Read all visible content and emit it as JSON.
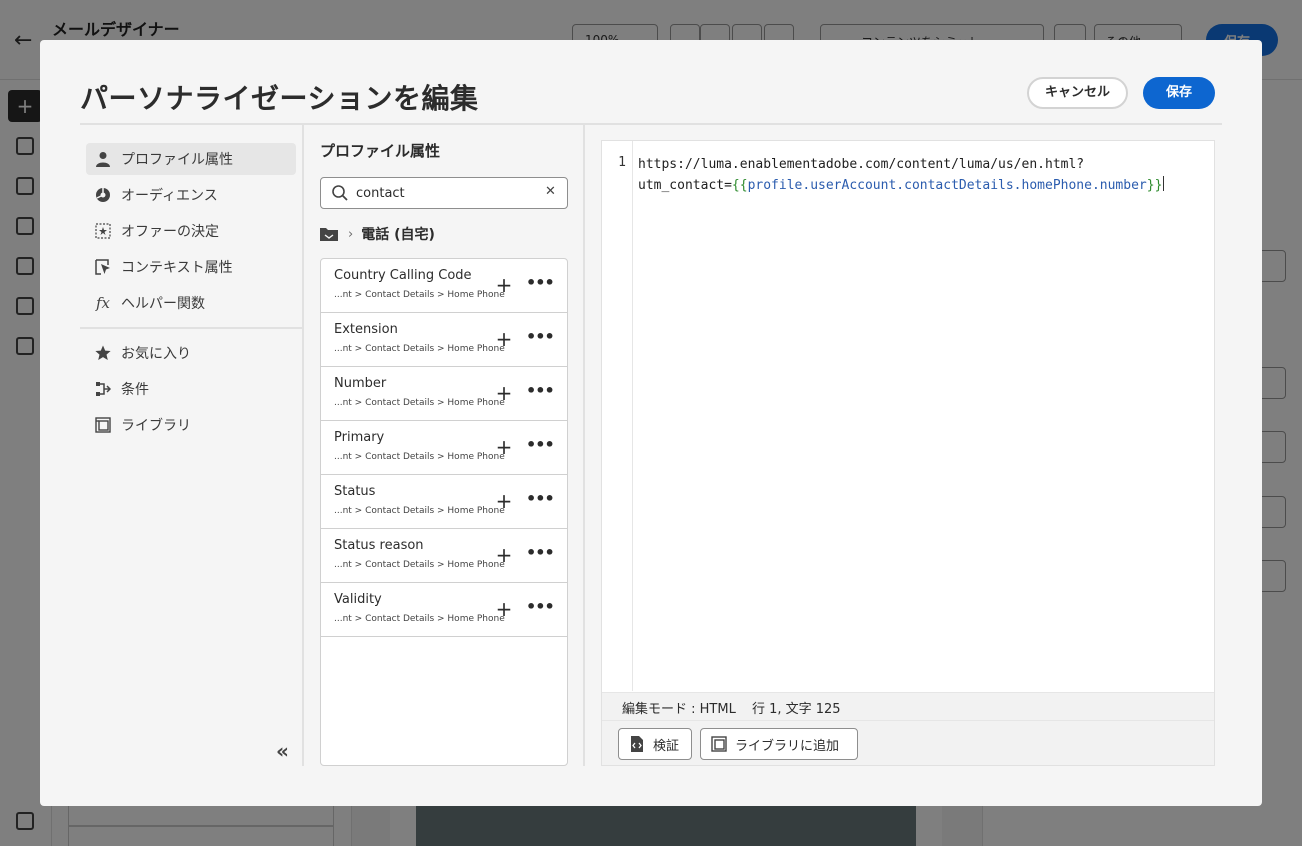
{
  "background": {
    "app_title": "メールデザイナー",
    "zoom": "100%",
    "simulate_label": "コンテンツをシミュレート",
    "more_label": "その他",
    "save_label": "保存"
  },
  "dialog": {
    "title": "パーソナライゼーションを編集",
    "cancel_label": "キャンセル",
    "save_label": "保存"
  },
  "leftnav": {
    "items": [
      {
        "label": "プロファイル属性",
        "icon": "person-icon"
      },
      {
        "label": "オーディエンス",
        "icon": "audience-icon"
      },
      {
        "label": "オファーの決定",
        "icon": "offer-icon"
      },
      {
        "label": "コンテキスト属性",
        "icon": "context-icon"
      },
      {
        "label": "ヘルパー関数",
        "icon": "function-icon"
      },
      {
        "label": "お気に入り",
        "icon": "star-icon"
      },
      {
        "label": "条件",
        "icon": "condition-icon"
      },
      {
        "label": "ライブラリ",
        "icon": "library-icon"
      }
    ],
    "function_glyph": "fx"
  },
  "middle": {
    "title": "プロファイル属性",
    "search": {
      "value": "contact",
      "placeholder": ""
    },
    "breadcrumb": "電話 (自宅)",
    "items": [
      {
        "name": "Country Calling Code",
        "path": "...nt > Contact Details > Home Phone"
      },
      {
        "name": "Extension",
        "path": "...nt > Contact Details > Home Phone"
      },
      {
        "name": "Number",
        "path": "...nt > Contact Details > Home Phone"
      },
      {
        "name": "Primary",
        "path": "...nt > Contact Details > Home Phone"
      },
      {
        "name": "Status",
        "path": "...nt > Contact Details > Home Phone"
      },
      {
        "name": "Status reason",
        "path": "...nt > Contact Details > Home Phone"
      },
      {
        "name": "Validity",
        "path": "...nt > Contact Details > Home Phone"
      }
    ]
  },
  "editor": {
    "line_number": "1",
    "line1": "https://luma.enablementadobe.com/content/luma/us/en.html?",
    "line2_prefix": "utm_contact=",
    "brace_open": "{{",
    "expression": "profile.userAccount.contactDetails.homePhone.number",
    "brace_close": "}}",
    "status": {
      "mode": "編集モード : HTML",
      "position": "行 1, 文字 125"
    },
    "validate_label": "検証",
    "add_library_label": "ライブラリに追加"
  },
  "colors": {
    "accent": "#0d66d0",
    "brace": "#2e8b2e",
    "expression": "#2b5cae"
  }
}
